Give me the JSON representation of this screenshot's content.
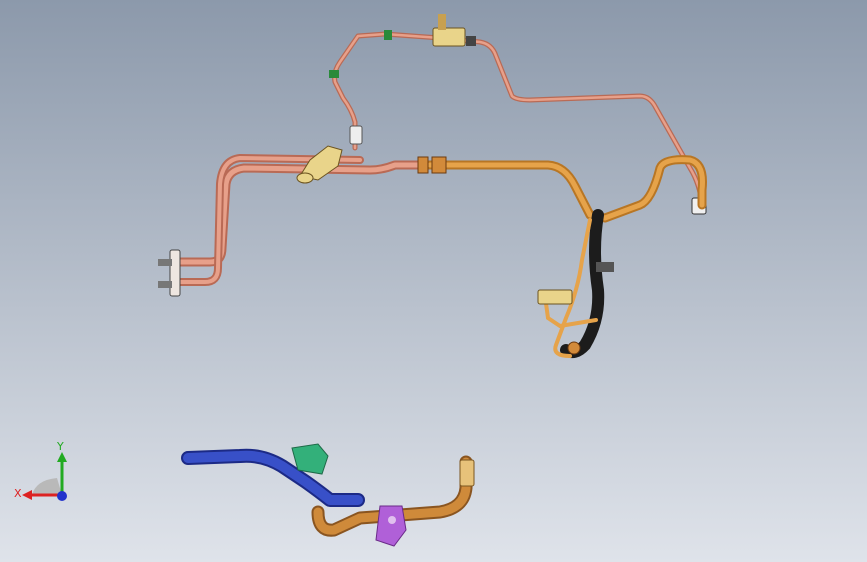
{
  "viewport": {
    "background_top": "#8c99ab",
    "background_bottom": "#dfe3ea"
  },
  "assemblies": {
    "upper_line_color": "#e7a08a",
    "upper_line_dark": "#b96a55",
    "orange_line_color": "#e6a34a",
    "orange_line_dark": "#b87624",
    "hose_color": "#1c1c1c",
    "blue_pipe_color": "#3850c8",
    "blue_pipe_dark": "#1c2a86",
    "copper_pipe_color": "#cf8a3a",
    "bracket_green": "#33b07a",
    "bracket_purple": "#b060d8",
    "bracket_yellow": "#e9d48a",
    "flange_color": "#eee6e0"
  },
  "triad": {
    "y_label": "Y",
    "x_label": "X",
    "y_color": "#22aa22",
    "x_color": "#dd2222",
    "z_color": "#2233cc"
  }
}
